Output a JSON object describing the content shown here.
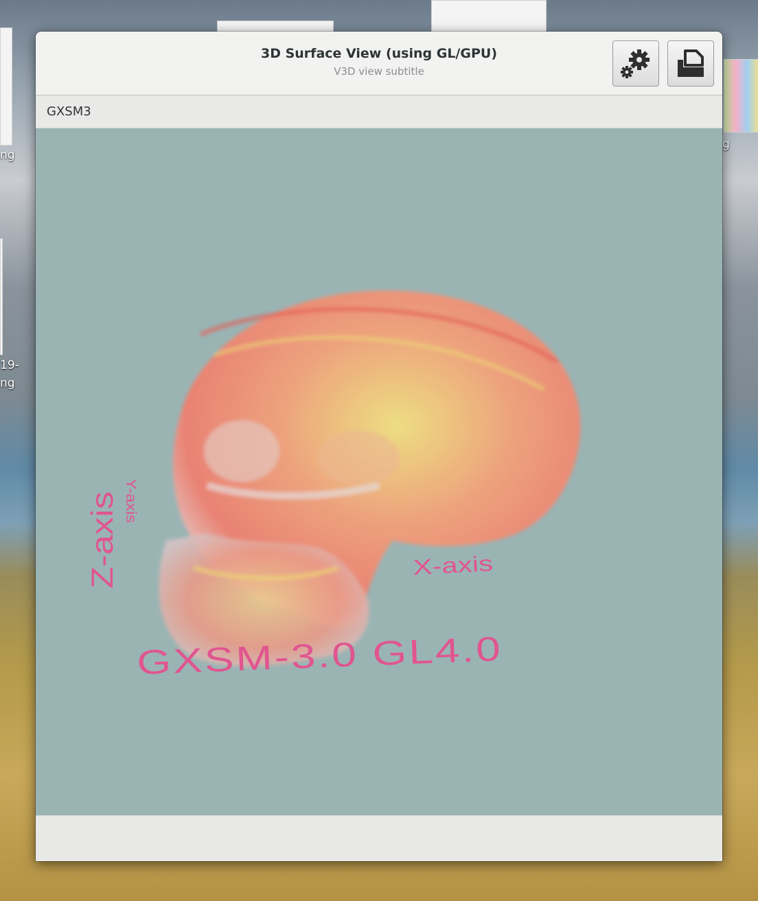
{
  "window": {
    "title": "3D Surface View (using GL/GPU)",
    "subtitle": "V3D view subtitle",
    "toolbar_label": "GXSM3"
  },
  "buttons": {
    "settings_icon": "gear-icon",
    "open_icon": "document-open-icon"
  },
  "scene": {
    "background_color": "#9ab4b4",
    "text_color": "#e0558f",
    "z_axis_label": "Z-axis",
    "y_axis_label": "Y-axis",
    "x_axis_label": "X-axis",
    "banner": "GXSM-3.0 GL4.0"
  },
  "desktop": {
    "label_1": "ng",
    "label_2": "19-",
    "label_3": "ng",
    "label_4": "g"
  }
}
